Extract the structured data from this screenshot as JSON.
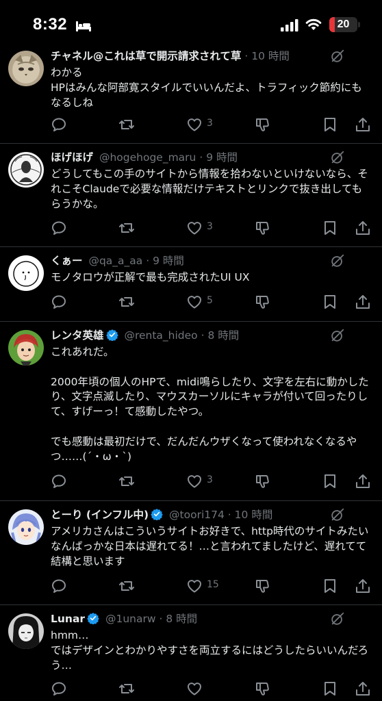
{
  "status_bar": {
    "time": "8:32",
    "battery": "20",
    "battery_level": 0.2,
    "battery_color": "#e5363a"
  },
  "icons": [
    "bed-icon",
    "signal-icon",
    "wifi-icon",
    "grok-icon",
    "reply-icon",
    "retweet-icon",
    "like-icon",
    "dislike-icon",
    "bookmark-icon",
    "share-icon",
    "verified-badge-icon"
  ],
  "accent_color": "#1d9bf0",
  "tweets": [
    {
      "name": "チャネル@これは草で開示請求されて草",
      "handle": "",
      "dot": "·",
      "time": "10 時間",
      "verified": false,
      "text": "わかる\nHPはみんな阿部寛スタイルでいいんだよ、トラフィック節約にもなるしね",
      "likes": "3"
    },
    {
      "name": "ほげほげ",
      "handle": "@hogehoge_maru",
      "dot": "·",
      "time": "9 時間",
      "verified": false,
      "text": "どうしてもこの手のサイトから情報を拾わないといけないなら、それこそClaudeで必要な情報だけテキストとリンクで抜き出してもらうかな。",
      "likes": "3"
    },
    {
      "name": "くぁー",
      "handle": "@qa_a_aa",
      "dot": "·",
      "time": "9 時間",
      "verified": false,
      "text": "モノタロウが正解で最も完成されたUI UX",
      "likes": "5"
    },
    {
      "name": "レンタ英雄",
      "handle": "@renta_hideo",
      "dot": "·",
      "time": "8 時間",
      "verified": true,
      "text": "これあれだ。\n\n2000年頃の個人のHPで、midi鳴らしたり、文字を左右に動かしたり、文字点滅したり、マウスカーソルにキャラが付いて回ったりして、すげーっ！て感動したやつ。\n\nでも感動は最初だけで、だんだんウザくなって使われなくなるやつ……(´・ω・`)",
      "likes": "3"
    },
    {
      "name": "とーり (インフル中)",
      "handle": "@toori174",
      "dot": "·",
      "time": "10 時間",
      "verified": true,
      "text": "アメリカさんはこういうサイトお好きで、http時代のサイトみたいなんばっかな日本は遅れてる！…と言われてましたけど、遅れてて結構と思います",
      "likes": "15"
    },
    {
      "name": "Lunar",
      "handle": "@1unarw",
      "dot": "·",
      "time": "8 時間",
      "verified": true,
      "text": "hmm…\nではデザインとわかりやすさを両立するにはどうしたらいいんだろう…",
      "likes": ""
    }
  ]
}
